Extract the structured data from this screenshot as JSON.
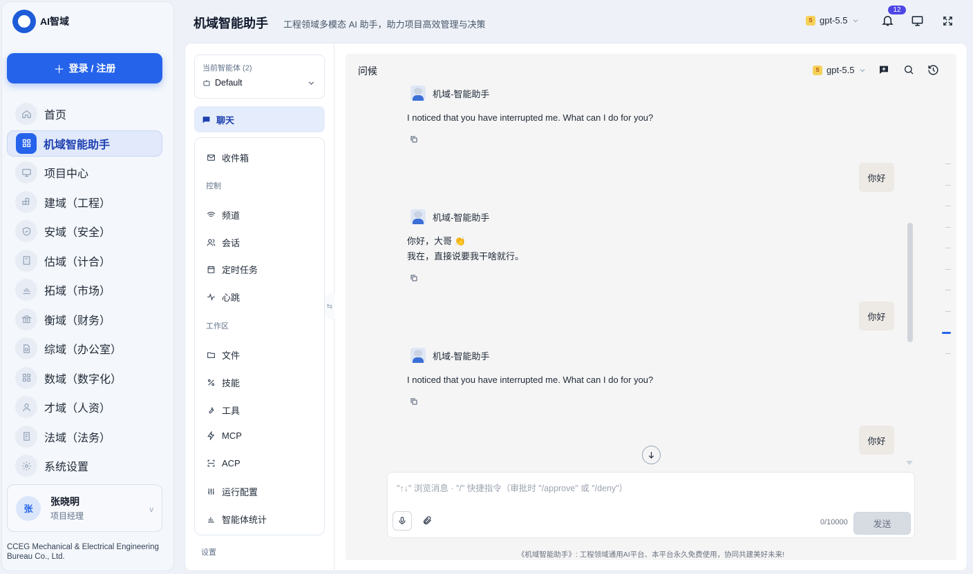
{
  "app": {
    "logo_text": "AI智域",
    "login_label": "登录 / 注册"
  },
  "nav": [
    {
      "label": "首页",
      "icon": "home-icon"
    },
    {
      "label": "机域智能助手",
      "icon": "grid-icon",
      "active": true
    },
    {
      "label": "项目中心",
      "icon": "monitor-icon"
    },
    {
      "label": "建域（工程）",
      "icon": "blocks-icon"
    },
    {
      "label": "安域（安全）",
      "icon": "shield-icon"
    },
    {
      "label": "估域（计合）",
      "icon": "calculator-icon"
    },
    {
      "label": "拓域（市场）",
      "icon": "bar-chart-icon"
    },
    {
      "label": "衡域（财务）",
      "icon": "bank-icon"
    },
    {
      "label": "综域（办公室）",
      "icon": "document-icon"
    },
    {
      "label": "数域（数字化）",
      "icon": "grid-icon"
    },
    {
      "label": "才域（人资）",
      "icon": "user-icon"
    },
    {
      "label": "法域（法务）",
      "icon": "law-icon"
    },
    {
      "label": "系统设置",
      "icon": "gear-icon"
    }
  ],
  "user": {
    "avatar": "张",
    "name": "张晓明",
    "role": "项目经理",
    "caret": "v"
  },
  "company": "CCEG Mechanical & Electrical Engineering Bureau Co., Ltd.",
  "header": {
    "title": "机域智能助手",
    "subtitle": "工程领域多模态 AI 助手，助力项目高效管理与决策",
    "model": "gpt-5.5",
    "notification_count": "12"
  },
  "agent": {
    "label": "当前智能体 (2)",
    "value": "Default"
  },
  "chat_tab": "聊天",
  "menu": {
    "inbox": "收件箱",
    "section_control": "控制",
    "channel": "频道",
    "session": "会话",
    "scheduled": "定时任务",
    "heartbeat": "心跳",
    "section_workspace": "工作区",
    "files": "文件",
    "skills": "技能",
    "tools": "工具",
    "mcp": "MCP",
    "acp": "ACP",
    "runtime": "运行配置",
    "stats": "智能体统计",
    "section_settings": "设置"
  },
  "chat": {
    "title": "问候",
    "model": "gpt-5.5",
    "bot_name": "机域-智能助手",
    "messages": [
      {
        "role": "bot",
        "text": "I noticed that you have interrupted me. What can I do for you?"
      },
      {
        "role": "user",
        "text": "你好"
      },
      {
        "role": "bot",
        "line1": "你好，大哥 👏",
        "line2": "我在，直接说要我干啥就行。"
      },
      {
        "role": "user",
        "text": "你好"
      },
      {
        "role": "bot",
        "text": "I noticed that you have interrupted me. What can I do for you?"
      },
      {
        "role": "user",
        "text": "你好"
      }
    ],
    "input_placeholder": "\"↑↓\" 浏览消息 · \"/\" 快捷指令（审批时 \"/approve\" 或 \"/deny\"）",
    "counter": "0/10000",
    "send_label": "发送",
    "footer": "《机域智能助手》: 工程领域通用AI平台、本平台永久免费使用，协同共建美好未来!"
  },
  "colors": {
    "accent": "#2563eb",
    "badge": "#4f46e5"
  }
}
